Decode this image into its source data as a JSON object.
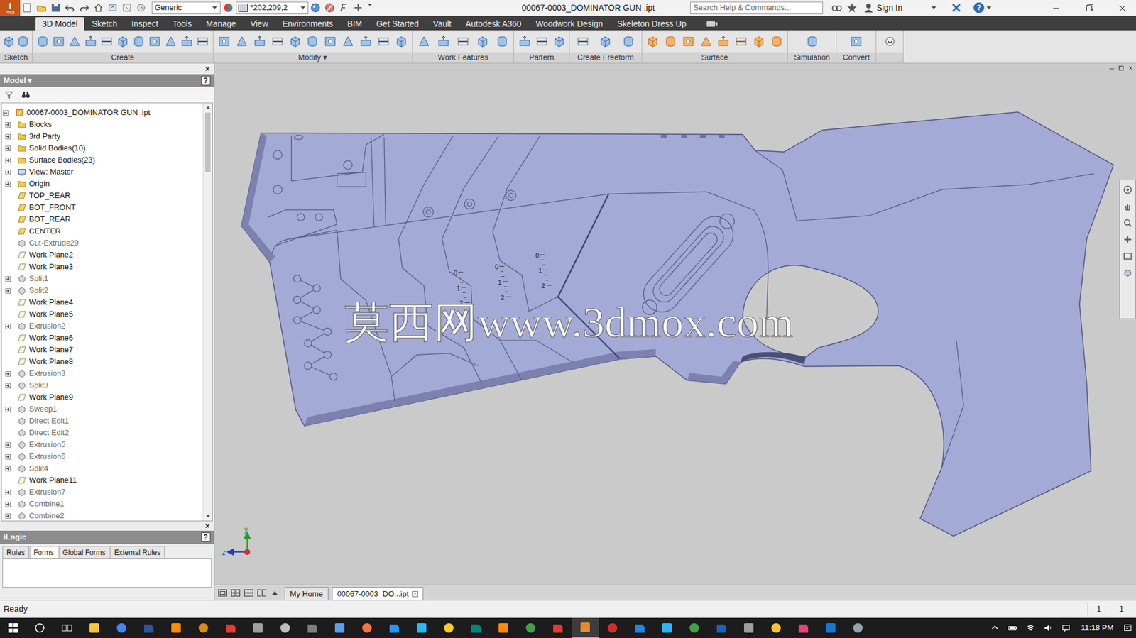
{
  "window": {
    "title": "00067-0003_DOMINATOR GUN .ipt",
    "logo": {
      "letter": "I",
      "edition": "PRO"
    },
    "appearance": "Generic",
    "color": "*202,209,2",
    "search": {
      "placeholder": "Search Help & Commands..."
    },
    "sign_in": "Sign In",
    "help": "?"
  },
  "ribbon": {
    "tabs": [
      {
        "label": "3D Model",
        "selected": true
      },
      {
        "label": "Sketch",
        "selected": false
      },
      {
        "label": "Inspect",
        "selected": false
      },
      {
        "label": "Tools",
        "selected": false
      },
      {
        "label": "Manage",
        "selected": false
      },
      {
        "label": "View",
        "selected": false
      },
      {
        "label": "Environments",
        "selected": false
      },
      {
        "label": "BIM",
        "selected": false
      },
      {
        "label": "Get Started",
        "selected": false
      },
      {
        "label": "Vault",
        "selected": false
      },
      {
        "label": "Autodesk A360",
        "selected": false
      },
      {
        "label": "Woodwork Design",
        "selected": false
      },
      {
        "label": "Skeleton Dress Up",
        "selected": false
      }
    ],
    "panels": [
      {
        "label": "Sketch"
      },
      {
        "label": "Create"
      },
      {
        "label": "Modify ▾"
      },
      {
        "label": "Work Features"
      },
      {
        "label": "Pattern"
      },
      {
        "label": "Create Freeform"
      },
      {
        "label": "Surface"
      },
      {
        "label": "Simulation"
      },
      {
        "label": "Convert"
      }
    ]
  },
  "browser": {
    "title": "Model ▾",
    "help": "?",
    "tree": [
      {
        "label": "00067-0003_DOMINATOR GUN .ipt",
        "kind": "root",
        "expandable": true,
        "expanded": true,
        "dim": false
      },
      {
        "label": "Blocks",
        "kind": "folder",
        "expandable": true,
        "expanded": false,
        "dim": false
      },
      {
        "label": "3rd Party",
        "kind": "folder",
        "expandable": true,
        "expanded": false,
        "dim": false
      },
      {
        "label": "Solid Bodies(10)",
        "kind": "folder",
        "expandable": true,
        "expanded": false,
        "dim": false
      },
      {
        "label": "Surface Bodies(23)",
        "kind": "folder",
        "expandable": true,
        "expanded": false,
        "dim": false
      },
      {
        "label": "View: Master",
        "kind": "view",
        "expandable": true,
        "expanded": false,
        "dim": false
      },
      {
        "label": "Origin",
        "kind": "folder",
        "expandable": true,
        "expanded": false,
        "dim": false
      },
      {
        "label": "TOP_REAR",
        "kind": "plane",
        "expandable": false,
        "expanded": false,
        "dim": false
      },
      {
        "label": "BOT_FRONT",
        "kind": "plane",
        "expandable": false,
        "expanded": false,
        "dim": false
      },
      {
        "label": "BOT_REAR",
        "kind": "plane",
        "expandable": false,
        "expanded": false,
        "dim": false
      },
      {
        "label": "CENTER",
        "kind": "plane",
        "expandable": false,
        "expanded": false,
        "dim": false
      },
      {
        "label": "Cut-Extrude29",
        "kind": "feature",
        "expandable": false,
        "expanded": false,
        "dim": true
      },
      {
        "label": "Work Plane2",
        "kind": "workplane",
        "expandable": false,
        "expanded": false,
        "dim": false
      },
      {
        "label": "Work Plane3",
        "kind": "workplane",
        "expandable": false,
        "expanded": false,
        "dim": false
      },
      {
        "label": "Split1",
        "kind": "feature",
        "expandable": true,
        "expanded": false,
        "dim": true
      },
      {
        "label": "Split2",
        "kind": "feature",
        "expandable": true,
        "expanded": false,
        "dim": true
      },
      {
        "label": "Work Plane4",
        "kind": "workplane",
        "expandable": false,
        "expanded": false,
        "dim": false
      },
      {
        "label": "Work Plane5",
        "kind": "workplane",
        "expandable": false,
        "expanded": false,
        "dim": false
      },
      {
        "label": "Extrusion2",
        "kind": "feature",
        "expandable": true,
        "expanded": false,
        "dim": true
      },
      {
        "label": "Work Plane6",
        "kind": "workplane",
        "expandable": false,
        "expanded": false,
        "dim": false
      },
      {
        "label": "Work Plane7",
        "kind": "workplane",
        "expandable": false,
        "expanded": false,
        "dim": false
      },
      {
        "label": "Work Plane8",
        "kind": "workplane",
        "expandable": false,
        "expanded": false,
        "dim": false
      },
      {
        "label": "Extrusion3",
        "kind": "feature",
        "expandable": true,
        "expanded": false,
        "dim": true
      },
      {
        "label": "Split3",
        "kind": "feature",
        "expandable": true,
        "expanded": false,
        "dim": true
      },
      {
        "label": "Work Plane9",
        "kind": "workplane",
        "expandable": false,
        "expanded": false,
        "dim": false
      },
      {
        "label": "Sweep1",
        "kind": "feature",
        "expandable": true,
        "expanded": false,
        "dim": true
      },
      {
        "label": "Direct Edit1",
        "kind": "feature",
        "expandable": false,
        "expanded": false,
        "dim": true
      },
      {
        "label": "Direct Edit2",
        "kind": "feature",
        "expandable": false,
        "expanded": false,
        "dim": true
      },
      {
        "label": "Extrusion5",
        "kind": "feature",
        "expandable": true,
        "expanded": false,
        "dim": true
      },
      {
        "label": "Extrusion6",
        "kind": "feature",
        "expandable": true,
        "expanded": false,
        "dim": true
      },
      {
        "label": "Split4",
        "kind": "feature",
        "expandable": true,
        "expanded": false,
        "dim": true
      },
      {
        "label": "Work Plane11",
        "kind": "workplane",
        "expandable": false,
        "expanded": false,
        "dim": false
      },
      {
        "label": "Extrusion7",
        "kind": "feature",
        "expandable": true,
        "expanded": false,
        "dim": true
      },
      {
        "label": "Combine1",
        "kind": "feature",
        "expandable": true,
        "expanded": false,
        "dim": true
      },
      {
        "label": "Combine2",
        "kind": "feature",
        "expandable": true,
        "expanded": false,
        "dim": true
      }
    ]
  },
  "ilogic": {
    "title": "iLogic",
    "help": "?",
    "tabs": [
      {
        "label": "Rules",
        "selected": false
      },
      {
        "label": "Forms",
        "selected": true
      },
      {
        "label": "Global Forms",
        "selected": false
      },
      {
        "label": "External Rules",
        "selected": false
      }
    ]
  },
  "viewport": {
    "watermark": "莫西网www.3dmox.com",
    "gauges": [
      {
        "labels": [
          "0",
          "1",
          "2"
        ]
      },
      {
        "labels": [
          "0",
          "1",
          "2"
        ]
      },
      {
        "labels": [
          "0",
          "1",
          "2"
        ]
      }
    ],
    "axes": {
      "y": "y",
      "z": "z"
    }
  },
  "document_tabs": [
    {
      "label": "My Home",
      "selected": false
    },
    {
      "label": "00067-0003_DO...ipt",
      "selected": true
    }
  ],
  "status_bar": {
    "text": "Ready",
    "counts": [
      "1",
      "1"
    ]
  },
  "taskbar": {
    "time": "11:18 PM"
  }
}
